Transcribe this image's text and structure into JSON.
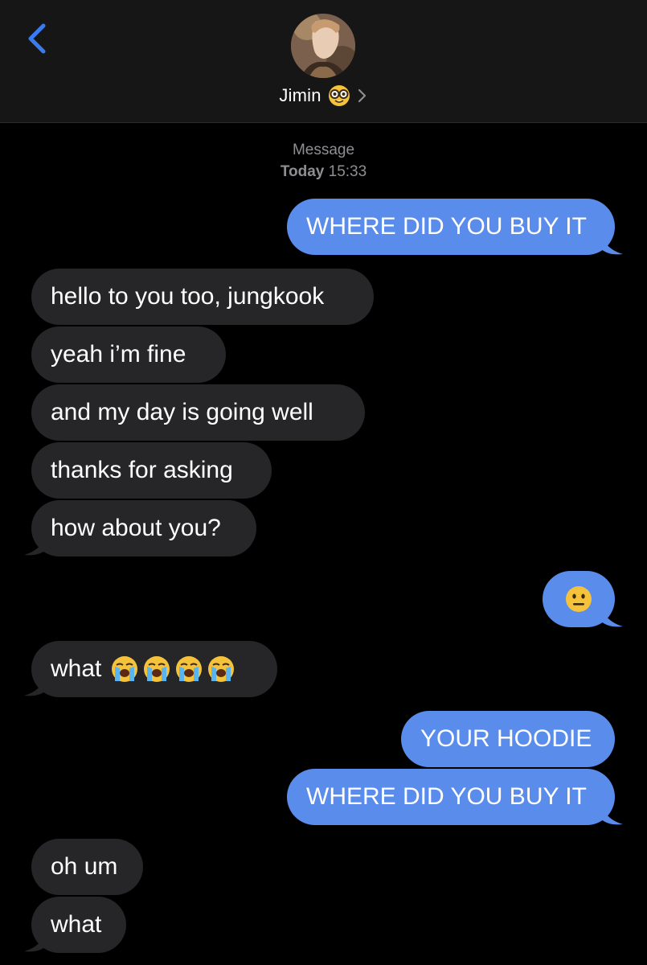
{
  "header": {
    "contact_name": "Jimin",
    "contact_emoji": "nerd-face-icon",
    "accent_color": "#3a7bf0"
  },
  "thread": {
    "label": "Message",
    "day": "Today",
    "time": "15:33"
  },
  "messages": [
    {
      "direction": "out",
      "text": "WHERE DID YOU BUY IT"
    },
    {
      "direction": "in",
      "text": "hello to you too, jungkook"
    },
    {
      "direction": "in",
      "text": "yeah i’m fine"
    },
    {
      "direction": "in",
      "text": "and my day is going well"
    },
    {
      "direction": "in",
      "text": "thanks for asking"
    },
    {
      "direction": "in",
      "text": "how about you?"
    },
    {
      "direction": "out",
      "emoji": "neutral-face-icon"
    },
    {
      "direction": "in",
      "text": "what",
      "emojis": [
        "loudly-crying-face-icon",
        "loudly-crying-face-icon",
        "loudly-crying-face-icon",
        "loudly-crying-face-icon"
      ]
    },
    {
      "direction": "out",
      "text": "YOUR HOODIE"
    },
    {
      "direction": "out",
      "text": "WHERE DID YOU BUY IT"
    },
    {
      "direction": "in",
      "text": "oh um"
    },
    {
      "direction": "in",
      "text": "what"
    }
  ],
  "colors": {
    "incoming_bubble": "#262628",
    "outgoing_bubble": "#5a8cec",
    "background": "#000000"
  }
}
